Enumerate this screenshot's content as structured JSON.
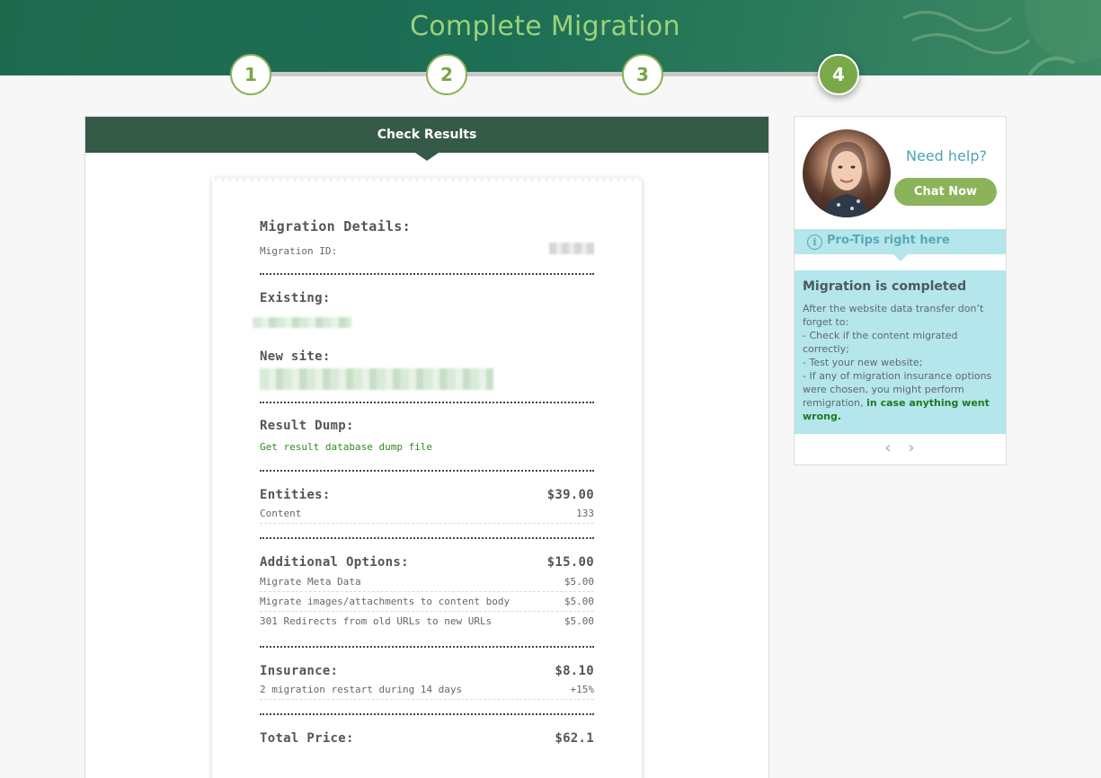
{
  "header": {
    "title": "Complete Migration"
  },
  "stepper": {
    "steps": [
      "1",
      "2",
      "3",
      "4"
    ],
    "active_step": "4"
  },
  "main": {
    "panel_title": "Check Results",
    "details_heading": "Migration Details:",
    "migration_id_label": "Migration ID:",
    "existing_label": "Existing:",
    "new_site_label": "New site:",
    "result_dump_label": "Result Dump:",
    "dump_link": "Get result database dump file",
    "entities": {
      "label": "Entities:",
      "total": "$39.00",
      "items": [
        {
          "name": "Content",
          "value": "133"
        }
      ]
    },
    "additional": {
      "label": "Additional Options:",
      "total": "$15.00",
      "items": [
        {
          "name": "Migrate Meta Data",
          "value": "$5.00"
        },
        {
          "name": "Migrate images/attachments to content body",
          "value": "$5.00"
        },
        {
          "name": "301 Redirects from old URLs to new URLs",
          "value": "$5.00"
        }
      ]
    },
    "insurance": {
      "label": "Insurance:",
      "total": "$8.10",
      "items": [
        {
          "name": "2 migration restart during 14 days",
          "value": "+15%"
        }
      ]
    },
    "total_label": "Total Price:",
    "total_value": "$62.1"
  },
  "sidebar": {
    "need_help": "Need help?",
    "chat_button": "Chat Now",
    "pro_tips": "Pro-Tips right here",
    "tip_title": "Migration is completed",
    "tip_lines": [
      "After the website data transfer don’t forget to:",
      "- Check if the content migrated correctly;",
      "- Test your new website;",
      "- If any of migration insurance options were chosen, you might perform remigration,"
    ],
    "tip_highlight": "in case anything went wrong."
  },
  "colors": {
    "accent_green": "#8bb35a",
    "header_dark": "#355a48",
    "tip_bg": "#b4e6ec"
  },
  "icons": {
    "info": "info-icon",
    "prev": "chevron-left-icon",
    "next": "chevron-right-icon"
  }
}
